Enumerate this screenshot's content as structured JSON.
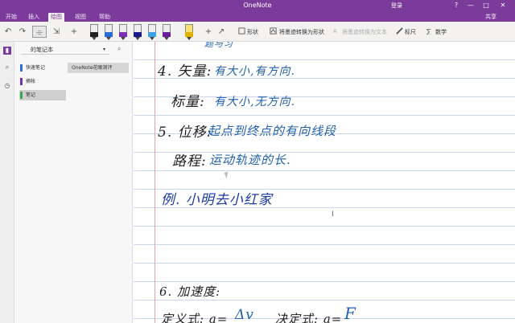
{
  "window": {
    "title": "OneNote",
    "signin_label": "登录",
    "controls": {
      "help": "?",
      "minimize": "—",
      "maximize": "□",
      "close": "✕"
    }
  },
  "menu": {
    "tabs": [
      {
        "label": "开始"
      },
      {
        "label": "插入"
      },
      {
        "label": "绘图",
        "active": true
      },
      {
        "label": "视图"
      },
      {
        "label": "帮助"
      }
    ],
    "share_label": "共享"
  },
  "ribbon": {
    "undo": "↶",
    "redo": "↷",
    "add_pen": "+",
    "pen_colors": [
      "#222222",
      "#2b6bd6",
      "#7a2fb0",
      "#1b1b8a",
      "#3aa0e0",
      "#6a1f9a",
      "#e0b000"
    ],
    "shapes_label": "形状",
    "ink_to_shape_label": "将墨迹转换为形状",
    "ink_to_text_label": "将墨迹转换为文本",
    "ruler_label": "标尺",
    "math_label": "数学"
  },
  "notebook": {
    "name": "的笔记本",
    "sections": [
      {
        "label": "快速笔记",
        "color": "#2f6fd6",
        "active": false
      },
      {
        "label": "摘帐",
        "color": "#7a2fb0",
        "active": false
      },
      {
        "label": "笔记",
        "color": "#3aa84a",
        "active": true
      }
    ],
    "page_label": "OneNote花眼测评"
  },
  "note": {
    "lines": [
      {
        "text": "题与习",
        "color": "blue"
      },
      {
        "text": "4. 矢量:",
        "color": "black"
      },
      {
        "text": "有大小,有方向.",
        "color": "blue"
      },
      {
        "text": "标量:",
        "color": "black"
      },
      {
        "text": "有大小,无方向.",
        "color": "blue"
      },
      {
        "text": "5. 位移:",
        "color": "black"
      },
      {
        "text": "起点到终点的有向线段",
        "color": "blue"
      },
      {
        "text": "路程:",
        "color": "black"
      },
      {
        "text": "运动轨迹的长.",
        "color": "blue"
      },
      {
        "text": "例. 小明去小红家",
        "color": "navy"
      },
      {
        "text": "6. 加速度:",
        "color": "black"
      },
      {
        "text": "定义式: a=",
        "color": "black"
      },
      {
        "text": "Δv",
        "color": "blue"
      },
      {
        "text": "决定式: a=",
        "color": "black"
      },
      {
        "text": "F",
        "color": "blue"
      }
    ]
  }
}
